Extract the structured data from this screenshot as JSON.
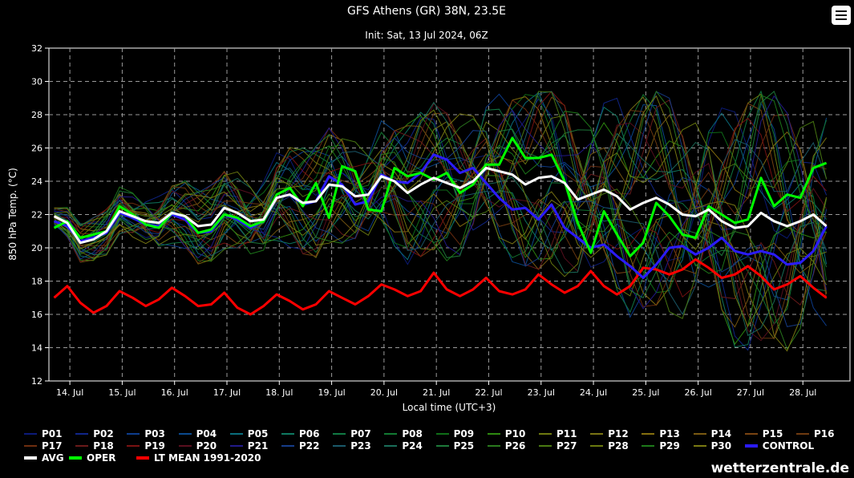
{
  "title": "GFS Athens (GR) 38N, 23.5E",
  "subtitle": "Init: Sat, 13 Jul 2024, 06Z",
  "credit": "wetterzentrale.de",
  "colors": {
    "background": "#000000",
    "grid": "#9a9a9a",
    "avg": "#ffffff",
    "oper": "#00ff00",
    "control": "#2b1bff",
    "lt_mean": "#ff0000"
  },
  "chart_data": {
    "type": "line",
    "title": "GFS Athens (GR) 38N, 23.5E",
    "subtitle": "Init: Sat, 13 Jul 2024, 06Z",
    "xlabel": "Local time (UTC+3)",
    "ylabel": "850 hPa Temp. (°C)",
    "ylim": [
      12,
      32
    ],
    "yticks": [
      12,
      14,
      16,
      18,
      20,
      22,
      24,
      26,
      28,
      30,
      32
    ],
    "x_start_day": 13.6,
    "x_end_day": 28.9,
    "x_step_hours": 6,
    "xtick_labels": [
      "14. Jul",
      "15. Jul",
      "16. Jul",
      "17. Jul",
      "18. Jul",
      "19. Jul",
      "20. Jul",
      "21. Jul",
      "22. Jul",
      "23. Jul",
      "24. Jul",
      "25. Jul",
      "26. Jul",
      "27. Jul",
      "28. Jul"
    ],
    "grid": true,
    "legend_position": "bottom",
    "series": [
      {
        "name": "LT MEAN 1991-2020",
        "color": "#ff0000",
        "width": 3,
        "values": [
          17.0,
          17.7,
          16.7,
          16.1,
          16.5,
          17.4,
          17.0,
          16.5,
          16.9,
          17.6,
          17.1,
          16.5,
          16.6,
          17.3,
          16.4,
          16.0,
          16.5,
          17.2,
          16.8,
          16.3,
          16.6,
          17.4,
          17.0,
          16.6,
          17.1,
          17.8,
          17.5,
          17.1,
          17.4,
          18.5,
          17.5,
          17.1,
          17.5,
          18.2,
          17.4,
          17.2,
          17.5,
          18.4,
          17.8,
          17.3,
          17.7,
          18.6,
          17.7,
          17.2,
          17.7,
          18.8,
          18.7,
          18.4,
          18.7,
          19.3,
          18.8,
          18.2,
          18.4,
          18.9,
          18.3,
          17.5,
          17.8,
          18.3,
          17.6,
          17.0
        ]
      },
      {
        "name": "CONTROL",
        "color": "#2b1bff",
        "width": 3,
        "values": [
          21.6,
          21.3,
          20.4,
          20.6,
          20.9,
          22.1,
          21.8,
          21.4,
          21.3,
          22.0,
          21.7,
          20.9,
          21.0,
          22.0,
          21.7,
          21.2,
          21.6,
          23.0,
          23.2,
          22.6,
          22.8,
          24.3,
          23.8,
          22.6,
          22.8,
          24.4,
          24.0,
          23.9,
          24.5,
          25.6,
          25.3,
          24.5,
          24.8,
          23.9,
          23.0,
          22.3,
          22.4,
          21.7,
          22.6,
          21.2,
          20.6,
          20.0,
          20.2,
          19.5,
          18.9,
          18.2,
          19.0,
          20.0,
          20.1,
          19.6,
          20.0,
          20.6,
          19.8,
          19.6,
          19.8,
          19.6,
          19.0,
          19.1,
          19.8,
          21.3
        ]
      },
      {
        "name": "OPER",
        "color": "#00ff00",
        "width": 3,
        "values": [
          21.2,
          21.6,
          20.6,
          20.8,
          21.0,
          22.5,
          22.0,
          21.4,
          21.2,
          22.1,
          21.9,
          20.9,
          21.1,
          22.0,
          21.8,
          21.3,
          21.6,
          23.2,
          23.6,
          22.5,
          23.9,
          21.8,
          24.9,
          24.6,
          22.3,
          22.2,
          24.8,
          24.3,
          24.5,
          24.1,
          24.5,
          23.3,
          23.8,
          25.0,
          25.0,
          26.6,
          25.4,
          25.4,
          25.6,
          24.0,
          21.5,
          19.7,
          22.2,
          20.8,
          19.5,
          20.3,
          22.7,
          21.9,
          20.8,
          20.6,
          22.5,
          22.0,
          21.5,
          21.7,
          24.2,
          22.5,
          23.2,
          23.0,
          24.8,
          25.1
        ]
      },
      {
        "name": "AVG",
        "color": "#ffffff",
        "width": 3,
        "values": [
          21.9,
          21.5,
          20.3,
          20.5,
          21.0,
          22.2,
          21.9,
          21.6,
          21.5,
          22.1,
          21.9,
          21.3,
          21.4,
          22.4,
          22.1,
          21.6,
          21.7,
          23.0,
          23.2,
          22.7,
          22.8,
          23.8,
          23.7,
          23.1,
          23.2,
          24.3,
          24.0,
          23.3,
          23.8,
          24.2,
          23.9,
          23.6,
          24.0,
          24.8,
          24.6,
          24.4,
          23.8,
          24.2,
          24.3,
          23.9,
          22.9,
          23.2,
          23.5,
          23.1,
          22.3,
          22.7,
          23.0,
          22.6,
          22.0,
          21.9,
          22.3,
          21.6,
          21.2,
          21.3,
          22.1,
          21.6,
          21.3,
          21.6,
          22.0,
          21.3
        ]
      }
    ]
  },
  "legend": {
    "rows": [
      [
        "P01",
        "P02",
        "P03",
        "P04",
        "P05",
        "P06",
        "P07",
        "P08",
        "P09",
        "P10",
        "P11",
        "P12",
        "P13",
        "P14",
        "P15",
        "P16"
      ],
      [
        "P17",
        "P18",
        "P19",
        "P20",
        "P21",
        "P22",
        "P23",
        "P24",
        "P25",
        "P26",
        "P27",
        "P28",
        "P29",
        "P30",
        "CONTROL"
      ],
      [
        "AVG",
        "OPER",
        "LT MEAN 1991-2020"
      ]
    ],
    "colors": {
      "P01": "#0c1b7a",
      "P02": "#10268a",
      "P03": "#0d3d8e",
      "P04": "#0b4b8f",
      "P05": "#0a6e7e",
      "P06": "#0f7a62",
      "P07": "#117a44",
      "P08": "#127a33",
      "P09": "#0f6e18",
      "P10": "#2e8a10",
      "P11": "#6e7a10",
      "P12": "#7a7514",
      "P13": "#86700f",
      "P14": "#7a5a12",
      "P15": "#7a4412",
      "P16": "#6e3a10",
      "P17": "#6e2e10",
      "P18": "#6a1a1a",
      "P19": "#7a1212",
      "P20": "#5a0f1f",
      "P21": "#221a8a",
      "P22": "#163d8a",
      "P23": "#1a5a6a",
      "P24": "#1a6e5a",
      "P25": "#1e7a3a",
      "P26": "#2a7a1e",
      "P27": "#4a7a12",
      "P28": "#6a7a0f",
      "P29": "#1e7a1a",
      "P30": "#7a7a12",
      "CONTROL": "#2b1bff",
      "AVG": "#ffffff",
      "OPER": "#00ff00",
      "LT MEAN 1991-2020": "#ff0000"
    }
  }
}
